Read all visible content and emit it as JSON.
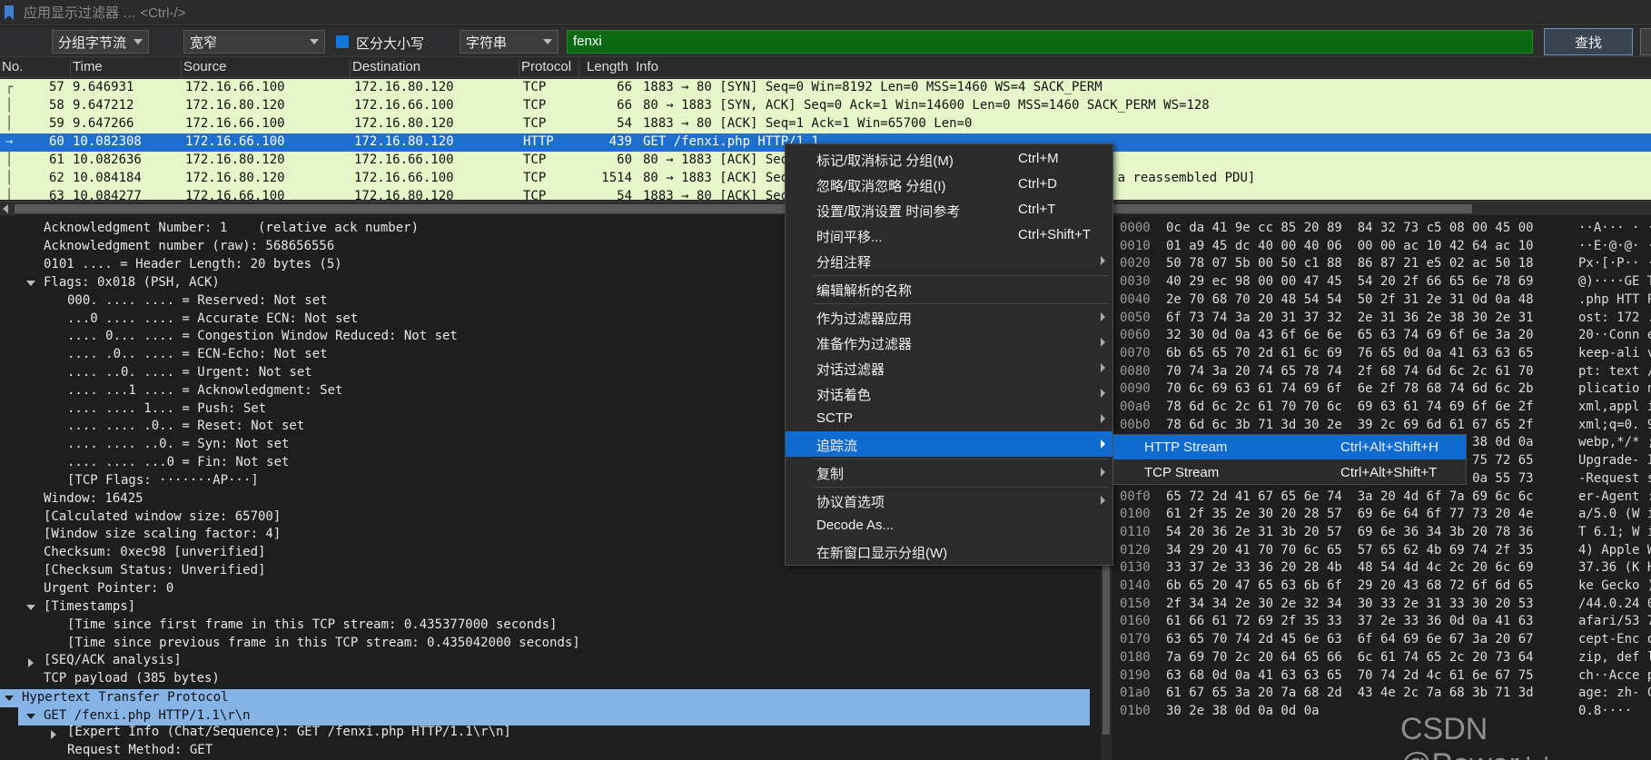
{
  "filter_bar": {
    "placeholder": "应用显示过滤器 … <Ctrl-/>"
  },
  "find_bar": {
    "search_in": "分组字节流",
    "char_width": "宽窄",
    "case_sensitive_label": "区分大小写",
    "case_sensitive_checked": true,
    "search_type": "字符串",
    "search_value": "fenxi",
    "find_button": "查找"
  },
  "columns": [
    "No.",
    "Time",
    "Source",
    "Destination",
    "Protocol",
    "Length",
    "Info"
  ],
  "packets": [
    {
      "no": "57",
      "time": "9.646931",
      "src": "172.16.66.100",
      "dst": "172.16.80.120",
      "proto": "TCP",
      "len": "66",
      "info": "1883 → 80 [SYN] Seq=0 Win=8192 Len=0 MSS=1460 WS=4 SACK_PERM"
    },
    {
      "no": "58",
      "time": "9.647212",
      "src": "172.16.80.120",
      "dst": "172.16.66.100",
      "proto": "TCP",
      "len": "66",
      "info": "80 → 1883 [SYN, ACK] Seq=0 Ack=1 Win=14600 Len=0 MSS=1460 SACK_PERM WS=128"
    },
    {
      "no": "59",
      "time": "9.647266",
      "src": "172.16.66.100",
      "dst": "172.16.80.120",
      "proto": "TCP",
      "len": "54",
      "info": "1883 → 80 [ACK] Seq=1 Ack=1 Win=65700 Len=0"
    },
    {
      "no": "60",
      "time": "10.082308",
      "src": "172.16.66.100",
      "dst": "172.16.80.120",
      "proto": "HTTP",
      "len": "439",
      "info": "GET /fenxi.php HTTP/1.1"
    },
    {
      "no": "61",
      "time": "10.082636",
      "src": "172.16.80.120",
      "dst": "172.16.66.100",
      "proto": "TCP",
      "len": "60",
      "info": "80 → 1883 [ACK] Seq"
    },
    {
      "no": "62",
      "time": "10.084184",
      "src": "172.16.80.120",
      "dst": "172.16.66.100",
      "proto": "TCP",
      "len": "1514",
      "info": "80 → 1883 [ACK] Seq                                     nt of a reassembled PDU]"
    },
    {
      "no": "63",
      "time": "10.084277",
      "src": "172.16.66.100",
      "dst": "172.16.80.120",
      "proto": "TCP",
      "len": "54",
      "info": "1883 → 80 [ACK] Seq"
    }
  ],
  "details": [
    {
      "text": "Acknowledgment Number: 1    (relative ack number)"
    },
    {
      "text": "Acknowledgment number (raw): 568656556"
    },
    {
      "text": "0101 .... = Header Length: 20 bytes (5)"
    },
    {
      "text": "Flags: 0x018 (PSH, ACK)"
    },
    {
      "text": "000. .... .... = Reserved: Not set"
    },
    {
      "text": "...0 .... .... = Accurate ECN: Not set"
    },
    {
      "text": ".... 0... .... = Congestion Window Reduced: Not set"
    },
    {
      "text": ".... .0.. .... = ECN-Echo: Not set"
    },
    {
      "text": ".... ..0. .... = Urgent: Not set"
    },
    {
      "text": ".... ...1 .... = Acknowledgment: Set"
    },
    {
      "text": ".... .... 1... = Push: Set"
    },
    {
      "text": ".... .... .0.. = Reset: Not set"
    },
    {
      "text": ".... .... ..0. = Syn: Not set"
    },
    {
      "text": ".... .... ...0 = Fin: Not set"
    },
    {
      "text": "[TCP Flags: ·······AP···]"
    },
    {
      "text": "Window: 16425"
    },
    {
      "text": "[Calculated window size: 65700]"
    },
    {
      "text": "[Window size scaling factor: 4]"
    },
    {
      "text": "Checksum: 0xec98 [unverified]"
    },
    {
      "text": "[Checksum Status: Unverified]"
    },
    {
      "text": "Urgent Pointer: 0"
    },
    {
      "text": "[Timestamps]"
    },
    {
      "text": "[Time since first frame in this TCP stream: 0.435377000 seconds]"
    },
    {
      "text": "[Time since previous frame in this TCP stream: 0.435042000 seconds]"
    },
    {
      "text": "[SEQ/ACK analysis]"
    },
    {
      "text": "TCP payload (385 bytes)"
    },
    {
      "text": "Hypertext Transfer Protocol"
    },
    {
      "text": "GET /fenxi.php HTTP/1.1\\r\\n"
    },
    {
      "text": "[Expert Info (Chat/Sequence): GET /fenxi.php HTTP/1.1\\r\\n]"
    },
    {
      "text": "Request Method: GET"
    }
  ],
  "bytes": [
    {
      "off": "0000",
      "hex": "0c da 41 9e cc 85 20 89  84 32 73 c5 08 00 45 00",
      "ascii": "··A··· · ·2s···E·"
    },
    {
      "off": "0010",
      "hex": "01 a9 45 dc 40 00 40 06  00 00 ac 10 42 64 ac 10",
      "ascii": "··E·@·@· ····Bd··"
    },
    {
      "off": "0020",
      "hex": "50 78 07 5b 00 50 c1 88  86 87 21 e5 02 ac 50 18",
      "ascii": "Px·[·P·· ··!···P·"
    },
    {
      "off": "0030",
      "hex": "40 29 ec 98 00 00 47 45  54 20 2f 66 65 6e 78 69",
      "ascii": "@)····GE T /fenxi"
    },
    {
      "off": "0040",
      "hex": "2e 70 68 70 20 48 54 54  50 2f 31 2e 31 0d 0a 48",
      "ascii": ".php HTT P/1.1··H"
    },
    {
      "off": "0050",
      "hex": "6f 73 74 3a 20 31 37 32  2e 31 36 2e 38 30 2e 31",
      "ascii": "ost: 172 .16.80.1"
    },
    {
      "off": "0060",
      "hex": "32 30 0d 0a 43 6f 6e 6e  65 63 74 69 6f 6e 3a 20",
      "ascii": "20··Conn ection: "
    },
    {
      "off": "0070",
      "hex": "6b 65 65 70 2d 61 6c 69  76 65 0d 0a 41 63 63 65",
      "ascii": "keep-ali ve··Acce"
    },
    {
      "off": "0080",
      "hex": "70 74 3a 20 74 65 78 74  2f 68 74 6d 6c 2c 61 70",
      "ascii": "pt: text /html,ap"
    },
    {
      "off": "0090",
      "hex": "70 6c 69 63 61 74 69 6f  6e 2f 78 68 74 6d 6c 2b",
      "ascii": "plicatio n/xhtml+"
    },
    {
      "off": "00a0",
      "hex": "78 6d 6c 2c 61 70 70 6c  69 63 61 74 69 6f 6e 2f",
      "ascii": "xml,appl ication/"
    },
    {
      "off": "00b0",
      "hex": "78 6d 6c 3b 71 3d 30 2e  39 2c 69 6d 61 67 65 2f",
      "ascii": "xml;q=0. 9,image/"
    },
    {
      "off": "00c0",
      "hex": "77 65 62 70 2c 2a 2f 2a  3b 71 3d 30 2e 38 0d 0a",
      "ascii": "webp,*/* ;q=0.8··"
    },
    {
      "off": "00d0",
      "hex": "55 70 67 72 61 64 65 2d  49 6e 73 65 63 75 72 65",
      "ascii": "Upgrade- Insecure"
    },
    {
      "off": "00e0",
      "hex": "2d 52 65 71 75 65 73 74  73 3a 20 31 0d 0a 55 73",
      "ascii": "-Request s: 1··Us"
    },
    {
      "off": "00f0",
      "hex": "65 72 2d 41 67 65 6e 74  3a 20 4d 6f 7a 69 6c 6c",
      "ascii": "er-Agent : Mozill"
    },
    {
      "off": "0100",
      "hex": "61 2f 35 2e 30 20 28 57  69 6e 64 6f 77 73 20 4e",
      "ascii": "a/5.0 (W indows N"
    },
    {
      "off": "0110",
      "hex": "54 20 36 2e 31 3b 20 57  69 6e 36 34 3b 20 78 36",
      "ascii": "T 6.1; W in64; x6"
    },
    {
      "off": "0120",
      "hex": "34 29 20 41 70 70 6c 65  57 65 62 4b 69 74 2f 35",
      "ascii": "4) Apple WebKit/5"
    },
    {
      "off": "0130",
      "hex": "33 37 2e 33 36 20 28 4b  48 54 4d 4c 2c 20 6c 69",
      "ascii": "37.36 (K HTML, li"
    },
    {
      "off": "0140",
      "hex": "6b 65 20 47 65 63 6b 6f  29 20 43 68 72 6f 6d 65",
      "ascii": "ke Gecko ) Chrome"
    },
    {
      "off": "0150",
      "hex": "2f 34 34 2e 30 2e 32 34  30 33 2e 31 33 30 20 53",
      "ascii": "/44.0.24 03.130 S"
    },
    {
      "off": "0160",
      "hex": "61 66 61 72 69 2f 35 33  37 2e 33 36 0d 0a 41 63",
      "ascii": "afari/53 7.36··Ac"
    },
    {
      "off": "0170",
      "hex": "63 65 70 74 2d 45 6e 63  6f 64 69 6e 67 3a 20 67",
      "ascii": "cept-Enc oding: g"
    },
    {
      "off": "0180",
      "hex": "7a 69 70 2c 20 64 65 66  6c 61 74 65 2c 20 73 64",
      "ascii": "zip, def late, sd"
    },
    {
      "off": "0190",
      "hex": "63 68 0d 0a 41 63 63 65  70 74 2d 4c 61 6e 67 75",
      "ascii": "ch··Acce pt-Langu"
    },
    {
      "off": "01a0",
      "hex": "61 67 65 3a 20 7a 68 2d  43 4e 2c 7a 68 3b 71 3d",
      "ascii": "age: zh- CN,zh;q="
    },
    {
      "off": "01b0",
      "hex": "30 2e 38 0d 0a 0d 0a",
      "ascii": "0.8····"
    }
  ],
  "context_menu": [
    {
      "label": "标记/取消标记 分组(M)",
      "shortcut": "Ctrl+M"
    },
    {
      "label": "忽略/取消忽略 分组(I)",
      "shortcut": "Ctrl+D"
    },
    {
      "label": "设置/取消设置 时间参考",
      "shortcut": "Ctrl+T"
    },
    {
      "label": "时间平移...",
      "shortcut": "Ctrl+Shift+T"
    },
    {
      "label": "分组注释",
      "shortcut": ""
    },
    {
      "label": "编辑解析的名称",
      "shortcut": ""
    },
    {
      "label": "作为过滤器应用",
      "shortcut": ""
    },
    {
      "label": "准备作为过滤器",
      "shortcut": ""
    },
    {
      "label": "对话过滤器",
      "shortcut": ""
    },
    {
      "label": "对话着色",
      "shortcut": ""
    },
    {
      "label": "SCTP",
      "shortcut": ""
    },
    {
      "label": "追踪流",
      "shortcut": ""
    },
    {
      "label": "复制",
      "shortcut": ""
    },
    {
      "label": "协议首选项",
      "shortcut": ""
    },
    {
      "label": "Decode As...",
      "shortcut": ""
    },
    {
      "label": "在新窗口显示分组(W)",
      "shortcut": ""
    }
  ],
  "follow_stream_submenu": [
    {
      "label": "HTTP Stream",
      "shortcut": "Ctrl+Alt+Shift+H"
    },
    {
      "label": "TCP Stream",
      "shortcut": "Ctrl+Alt+Shift+T"
    }
  ],
  "watermark": "CSDN @Power++",
  "colors": {
    "selected": "#1f6fd1",
    "tcp_row_bg": "#e7f6c8",
    "highlight": "#86b4e6",
    "find_green": "#0b6a11"
  }
}
